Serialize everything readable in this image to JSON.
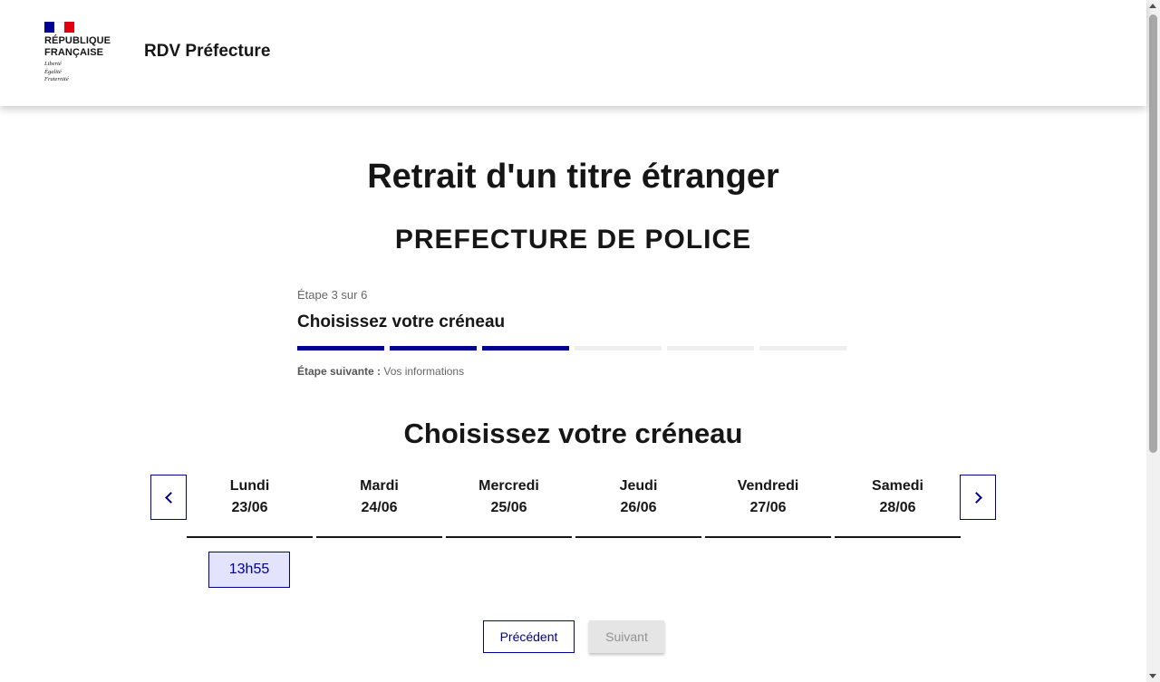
{
  "header": {
    "logo_name": "RÉPUBLIQUE\nFRANÇAISE",
    "logo_motto": "Liberté\nÉgalité\nFraternité",
    "service_title": "RDV Préfecture"
  },
  "main": {
    "title": "Retrait d'un titre étranger",
    "prefecture": "PREFECTURE DE POLICE"
  },
  "stepper": {
    "state": "Étape 3 sur 6",
    "current_step": 3,
    "total_steps": 6,
    "title": "Choisissez votre créneau",
    "next_label": "Étape suivante :",
    "next_value": " Vos informations"
  },
  "slots": {
    "title": "Choisissez votre créneau",
    "days": [
      {
        "name": "Lundi",
        "date": "23/06"
      },
      {
        "name": "Mardi",
        "date": "24/06"
      },
      {
        "name": "Mercredi",
        "date": "25/06"
      },
      {
        "name": "Jeudi",
        "date": "26/06"
      },
      {
        "name": "Vendredi",
        "date": "27/06"
      },
      {
        "name": "Samedi",
        "date": "28/06"
      }
    ],
    "available": [
      {
        "day": "Lundi",
        "time": "13h55"
      }
    ]
  },
  "actions": {
    "previous": "Précédent",
    "next": "Suivant"
  },
  "colors": {
    "primary": "#000091",
    "slot_bg": "#e3e3fd",
    "disabled_bg": "#e5e5e5",
    "flag_blue": "#000091",
    "flag_red": "#e1000f"
  }
}
